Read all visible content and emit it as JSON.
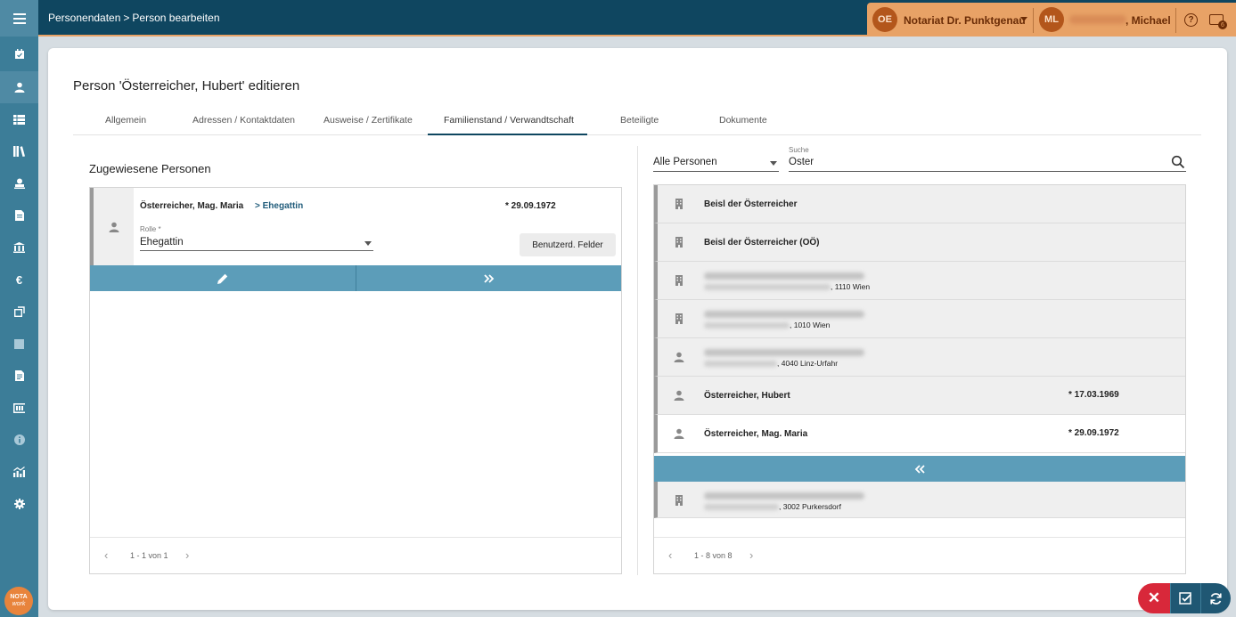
{
  "breadcrumb": {
    "parent": "Personendaten",
    "separator": ">",
    "current": "Person bearbeiten"
  },
  "header": {
    "org_initials": "OE",
    "org_name": "Notariat Dr. Punktgenau",
    "user_initials": "ML",
    "user_name": ", Michael",
    "mail_count": "6"
  },
  "page": {
    "title": "Person 'Österreicher, Hubert' editieren"
  },
  "tabs": [
    {
      "label": "Allgemein"
    },
    {
      "label": "Adressen / Kontaktdaten"
    },
    {
      "label": "Ausweise / Zertifikate"
    },
    {
      "label": "Familienstand / Verwandtschaft"
    },
    {
      "label": "Beteiligte"
    },
    {
      "label": "Dokumente"
    }
  ],
  "assigned": {
    "title": "Zugewiesene Personen",
    "entry": {
      "name": "Österreicher, Mag. Maria",
      "relation": "> Ehegattin",
      "birth": "* 29.09.1972",
      "role_label": "Rolle *",
      "role_value": "Ehegattin",
      "custom_fields_label": "Benutzerd. Felder"
    },
    "pager": "1 - 1 von 1"
  },
  "search": {
    "filter_value": "Alle Personen",
    "label": "Suche",
    "value": "Oster"
  },
  "results": {
    "rows": [
      {
        "type": "company",
        "name": "Beisl der Österreicher",
        "sub": "",
        "birth": ""
      },
      {
        "type": "company",
        "name": "Beisl der Österreicher (OÖ)",
        "sub": "",
        "birth": ""
      },
      {
        "type": "company",
        "name": "",
        "sub": ", 1110 Wien",
        "birth": ""
      },
      {
        "type": "company",
        "name": "",
        "sub": ", 1010 Wien",
        "birth": ""
      },
      {
        "type": "person",
        "name": "",
        "sub": ", 4040 Linz-Urfahr",
        "birth": ""
      },
      {
        "type": "person",
        "name": "Österreicher, Hubert",
        "sub": "",
        "birth": "* 17.03.1969"
      },
      {
        "type": "person",
        "name": "Österreicher, Mag. Maria",
        "sub": "",
        "birth": "* 29.09.1972"
      },
      {
        "type": "company",
        "name": "",
        "sub": ", 3002 Purkersdorf",
        "birth": ""
      }
    ],
    "pager": "1 - 8 von 8"
  },
  "logo": {
    "line1": "NOTA",
    "line2": "work"
  },
  "colors": {
    "navy": "#0f4660",
    "sidebar": "#3c7d98",
    "accent": "#e8a266",
    "action": "#5c9db9",
    "danger": "#d8283a"
  }
}
